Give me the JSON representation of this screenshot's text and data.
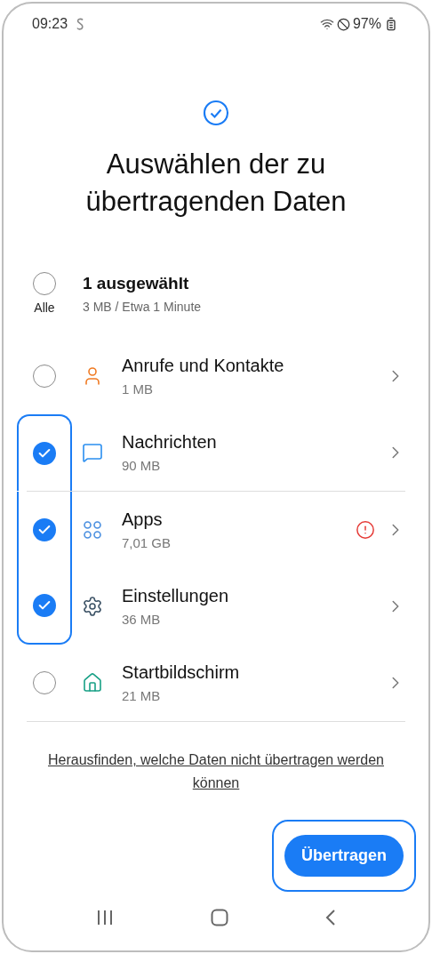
{
  "status_bar": {
    "time": "09:23",
    "battery": "97%"
  },
  "title": "Auswählen der zu übertragenden Daten",
  "select_all": {
    "checked": false,
    "label": "Alle",
    "summary": "1 ausgewählt",
    "detail": "3 MB / Etwa 1 Minute"
  },
  "categories": [
    {
      "kind": "contacts",
      "name": "Anrufe und Kontakte",
      "size": "1 MB",
      "checked": false,
      "highlighted": false,
      "warning": false,
      "divider_after": false
    },
    {
      "kind": "messages",
      "name": "Nachrichten",
      "size": "90 MB",
      "checked": true,
      "highlighted": true,
      "warning": false,
      "divider_after": true
    },
    {
      "kind": "apps",
      "name": "Apps",
      "size": "7,01 GB",
      "checked": true,
      "highlighted": true,
      "warning": true,
      "divider_after": false
    },
    {
      "kind": "settings",
      "name": "Einstellungen",
      "size": "36 MB",
      "checked": true,
      "highlighted": true,
      "warning": false,
      "divider_after": false
    },
    {
      "kind": "home",
      "name": "Startbildschirm",
      "size": "21 MB",
      "checked": false,
      "highlighted": false,
      "warning": false,
      "divider_after": true
    }
  ],
  "info_link": "Herausfinden, welche Daten nicht übertragen werden können",
  "transfer_button": {
    "label": "Übertragen",
    "highlighted": true
  }
}
